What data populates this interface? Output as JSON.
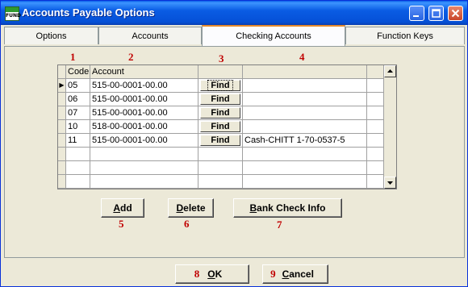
{
  "window": {
    "title": "Accounts Payable Options",
    "icon_text": "FUND"
  },
  "tabs": [
    {
      "label": "Options"
    },
    {
      "label": "Accounts"
    },
    {
      "label": "Checking Accounts"
    },
    {
      "label": "Function Keys"
    }
  ],
  "active_tab": "Checking Accounts",
  "annotations": {
    "n1": "1",
    "n2": "2",
    "n3": "3",
    "n4": "4",
    "n5": "5",
    "n6": "6",
    "n7": "7",
    "n8": "8",
    "n9": "9"
  },
  "grid": {
    "headers": {
      "code": "Code",
      "account": "Account",
      "find": "",
      "description": ""
    },
    "find_label": "Find",
    "rows": [
      {
        "code": "05",
        "account": "515-00-0001-00.00",
        "description": ""
      },
      {
        "code": "06",
        "account": "515-00-0001-00.00",
        "description": ""
      },
      {
        "code": "07",
        "account": "515-00-0001-00.00",
        "description": ""
      },
      {
        "code": "10",
        "account": "518-00-0001-00.00",
        "description": ""
      },
      {
        "code": "11",
        "account": "515-00-0001-00.00",
        "description": "Cash-CHITT 1-70-0537-5"
      }
    ],
    "current_row_marker": "▶"
  },
  "buttons": {
    "add": {
      "mnemonic": "A",
      "rest": "dd"
    },
    "delete": {
      "mnemonic": "D",
      "rest": "elete"
    },
    "bank": {
      "mnemonic": "B",
      "rest": "ank Check Info"
    },
    "ok": {
      "mnemonic": "O",
      "rest": "K"
    },
    "cancel": {
      "mnemonic": "C",
      "rest": "ancel"
    }
  },
  "colors": {
    "titlebar": "#0a5ce4",
    "annotation": "#c00000",
    "active_tab_accent": "#e68b2c",
    "face": "#ece9d8"
  },
  "icons": [
    "fund-app-icon",
    "minimize-icon",
    "maximize-icon",
    "close-icon",
    "scroll-up-icon",
    "scroll-down-icon",
    "row-pointer-icon"
  ]
}
